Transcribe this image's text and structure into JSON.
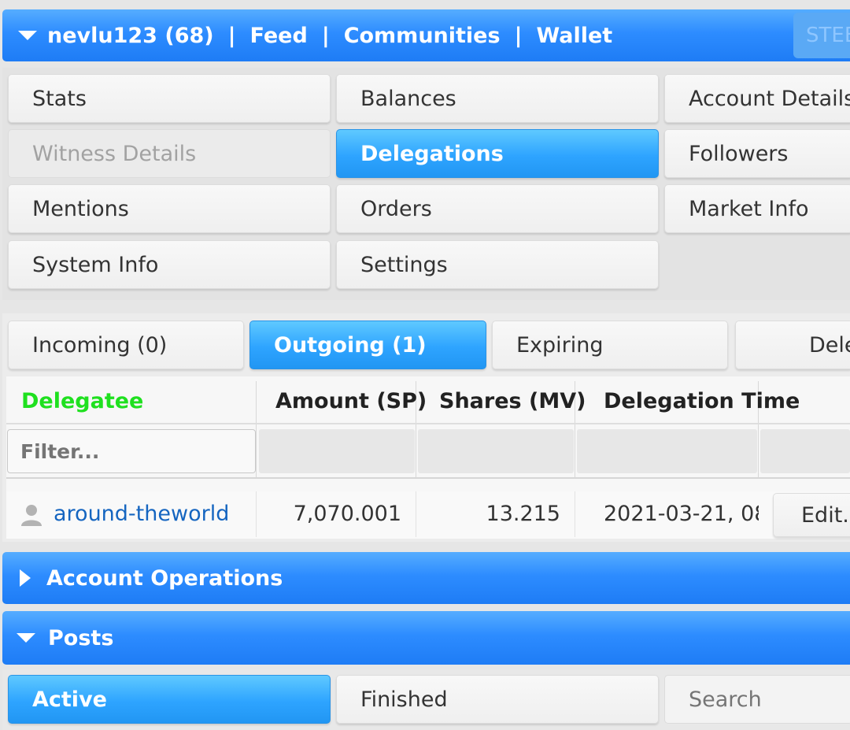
{
  "nav": {
    "user": "nevlu123 (68)",
    "sep": "|",
    "feed": "Feed",
    "communities": "Communities",
    "wallet": "Wallet",
    "right_label": "STEE"
  },
  "menu": {
    "items": [
      {
        "label": "Stats"
      },
      {
        "label": "Balances"
      },
      {
        "label": "Account Details"
      },
      {
        "label": "Witness Details"
      },
      {
        "label": "Delegations"
      },
      {
        "label": "Followers"
      },
      {
        "label": "Mentions"
      },
      {
        "label": "Orders"
      },
      {
        "label": "Market Info"
      },
      {
        "label": "System Info"
      },
      {
        "label": "Settings"
      }
    ]
  },
  "delegation_tabs": {
    "incoming": "Incoming (0)",
    "outgoing": "Outgoing (1)",
    "expiring": "Expiring",
    "fourth": "Dele"
  },
  "table": {
    "headers": [
      "Delegatee",
      "Amount (SP)",
      "Shares (MV)",
      "Delegation Time"
    ],
    "filter_placeholder": "Filter...",
    "rows": [
      {
        "delegatee": "around-theworld",
        "amount": "7,070.001",
        "shares": "13.215",
        "time": "2021-03-21, 08:",
        "action": "Edit..."
      }
    ]
  },
  "sections": {
    "account_operations": "Account Operations",
    "posts": "Posts"
  },
  "posts_tabs": {
    "active": "Active",
    "finished": "Finished",
    "search_placeholder": "Search"
  },
  "colors": {
    "accent_blue": "#2d8cff",
    "active_button": "#2ea4ff",
    "sorted_header_green": "#1fe01f",
    "link_blue": "#1565c0"
  }
}
